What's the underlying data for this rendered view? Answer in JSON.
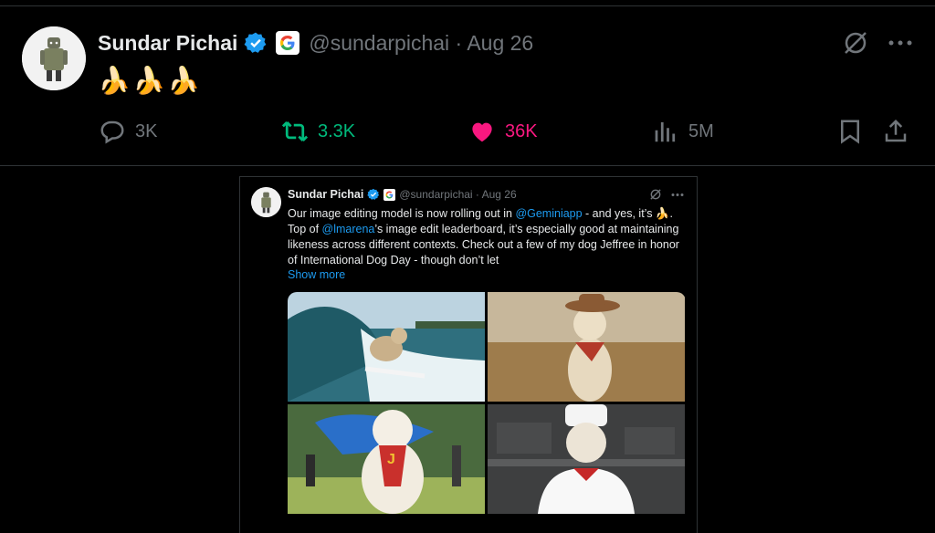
{
  "tweet": {
    "author": {
      "name": "Sundar Pichai",
      "handle": "@sundarpichai · Aug 26",
      "avatar": "android-figure-avatar",
      "verified_icon": "verified-badge-icon",
      "affiliation_icon": "google-g-logo-icon"
    },
    "text": "🍌🍌🍌",
    "top_icons": {
      "grok": "grok-icon",
      "more": "more-icon"
    },
    "actions": {
      "reply": {
        "icon": "reply-icon",
        "count": "3K"
      },
      "retweet": {
        "icon": "retweet-icon",
        "count": "3.3K",
        "color": "#00ba7c"
      },
      "like": {
        "icon": "heart-icon",
        "count": "36K",
        "color": "#f91880"
      },
      "views": {
        "icon": "views-icon",
        "count": "5M"
      },
      "bookmark": {
        "icon": "bookmark-icon"
      },
      "share": {
        "icon": "share-icon"
      }
    }
  },
  "quoted": {
    "author": {
      "name": "Sundar Pichai",
      "handle": "@sundarpichai · Aug 26"
    },
    "text": {
      "part1": "Our image editing model is now rolling out in ",
      "mention1": "@Geminiapp",
      "part2": " - and yes, it’s 🍌. Top of ",
      "mention2": "@lmarena",
      "part3": "’s image edit leaderboard, it’s especially good at maintaining likeness across different contexts. Check out a few of my dog Jeffree in honor of International Dog Day - though don’t let"
    },
    "show_more": "Show more",
    "photos": [
      {
        "name": "dog-surfing-photo"
      },
      {
        "name": "dog-cowboy-photo"
      },
      {
        "name": "dog-superhero-photo"
      },
      {
        "name": "dog-chef-photo"
      }
    ]
  },
  "colors": {
    "background": "#000000",
    "link": "#1d9bf0",
    "muted": "#71767b",
    "text": "#e7e9ea"
  }
}
